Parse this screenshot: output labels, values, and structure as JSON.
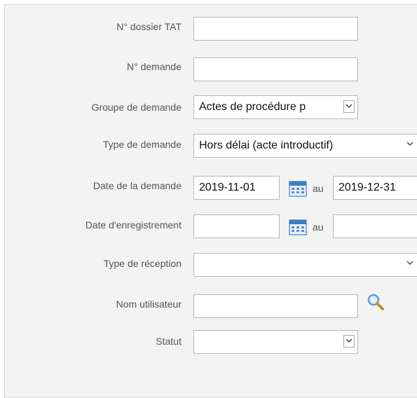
{
  "form": {
    "dossier_label": "N° dossier TAT",
    "dossier_value": "",
    "demande_label": "N° demande",
    "demande_value": "",
    "groupe_label": "Groupe de demande",
    "groupe_value": "Actes de procédure p",
    "type_label": "Type de demande",
    "type_value": "Hors délai (acte introductif)",
    "date_demande_label": "Date de la demande",
    "date_demande_from": "2019-11-01",
    "date_demande_sep": "au",
    "date_demande_to": "2019-12-31",
    "date_enr_label": "Date d'enregistrement",
    "date_enr_from": "",
    "date_enr_sep": "au",
    "date_enr_to": "",
    "reception_label": "Type de réception",
    "reception_value": "",
    "user_label": "Nom utilisateur",
    "user_value": "",
    "statut_label": "Statut",
    "statut_value": ""
  },
  "icons": {
    "calendar": "calendar-icon",
    "search": "magnifier-icon",
    "dropdown": "chevron-down-icon"
  },
  "colors": {
    "panel_bg": "#f3f3f3",
    "label": "#555555",
    "calendar_blue": "#3b7fc4",
    "search_blue": "#5aa0d8"
  }
}
